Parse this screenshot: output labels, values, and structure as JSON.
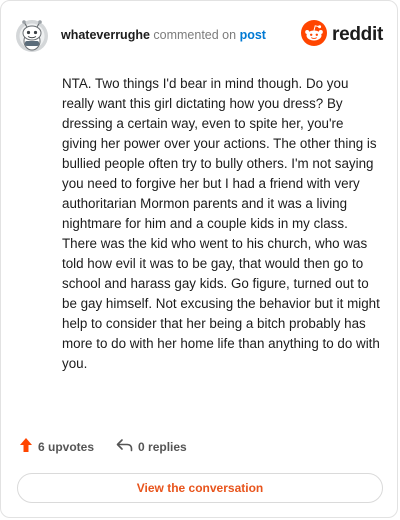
{
  "header": {
    "username": "whateverrughe",
    "action_text": "commented on",
    "post_link": "post",
    "brand_name": "reddit"
  },
  "comment": {
    "text": "NTA. Two things I'd bear in mind though. Do you really want this girl dictating how you dress? By dressing a certain way, even to spite her, you're giving her power over your actions. The other thing is bullied people often try to bully others. I'm not saying you need to forgive her but I had a friend with very authoritarian Mormon parents and it was a living nightmare for him and a couple kids in my class. There was the kid who went to his church, who was told how evil it was to be gay, that would then go to school and harass gay kids. Go figure, turned out to be gay himself. Not excusing the behavior but it might help to consider that her being a bitch probably has more to do with her home life than anything to do with you."
  },
  "stats": {
    "upvotes_label": "6 upvotes",
    "replies_label": "0 replies"
  },
  "footer": {
    "view_button_label": "View the conversation"
  },
  "icons": {
    "avatar": "snoo-avatar-icon",
    "brand": "reddit-logo-icon",
    "upvote": "upvote-arrow-icon",
    "reply": "reply-arrow-icon"
  },
  "colors": {
    "brand_orange": "#ff4500",
    "link_blue": "#0079d3",
    "button_text": "#e8541c"
  }
}
